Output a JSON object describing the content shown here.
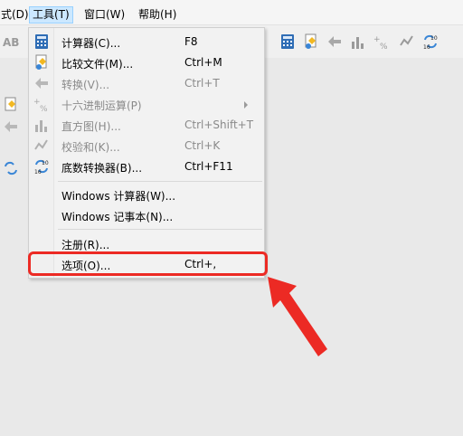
{
  "menubar": {
    "items": [
      {
        "label": "式(D)"
      },
      {
        "label": "工具(T)"
      },
      {
        "label": "窗口(W)"
      },
      {
        "label": "帮助(H)"
      }
    ]
  },
  "toolbar": {
    "icons": [
      "text-style-icon",
      "calculator-icon",
      "compare-files-icon",
      "convert-icon",
      "histogram-icon",
      "hex-math-icon",
      "checksum-icon",
      "base-converter-icon"
    ]
  },
  "tools_menu": {
    "items": [
      {
        "label": "计算器(C)...",
        "shortcut": "F8",
        "icon": "calculator-icon",
        "enabled": true
      },
      {
        "label": "比较文件(M)...",
        "shortcut": "Ctrl+M",
        "icon": "compare-files-icon",
        "enabled": true
      },
      {
        "label": "转换(V)...",
        "shortcut": "Ctrl+T",
        "icon": "convert-icon",
        "enabled": false
      },
      {
        "label": "十六进制运算(P)",
        "shortcut": "",
        "icon": "hex-math-icon",
        "enabled": false,
        "has_submenu": true
      },
      {
        "label": "直方图(H)...",
        "shortcut": "Ctrl+Shift+T",
        "icon": "histogram-icon",
        "enabled": false
      },
      {
        "label": "校验和(K)...",
        "shortcut": "Ctrl+K",
        "icon": "checksum-icon",
        "enabled": false
      },
      {
        "label": "底数转换器(B)...",
        "shortcut": "Ctrl+F11",
        "icon": "base-converter-icon",
        "enabled": true
      },
      {
        "label": "Windows 计算器(W)...",
        "shortcut": "",
        "enabled": true
      },
      {
        "label": "Windows 记事本(N)...",
        "shortcut": "",
        "enabled": true
      },
      {
        "label": "注册(R)...",
        "shortcut": "",
        "enabled": true
      },
      {
        "label": "选项(O)...",
        "shortcut": "Ctrl+,",
        "enabled": true,
        "highlighted": true
      }
    ],
    "icon_labels": {
      "base_top": "10",
      "base_bottom": "16"
    }
  },
  "colors": {
    "highlight_red": "#ec2a24",
    "menu_selected": "#cce8ff",
    "calculator_blue": "#2f6db5"
  }
}
